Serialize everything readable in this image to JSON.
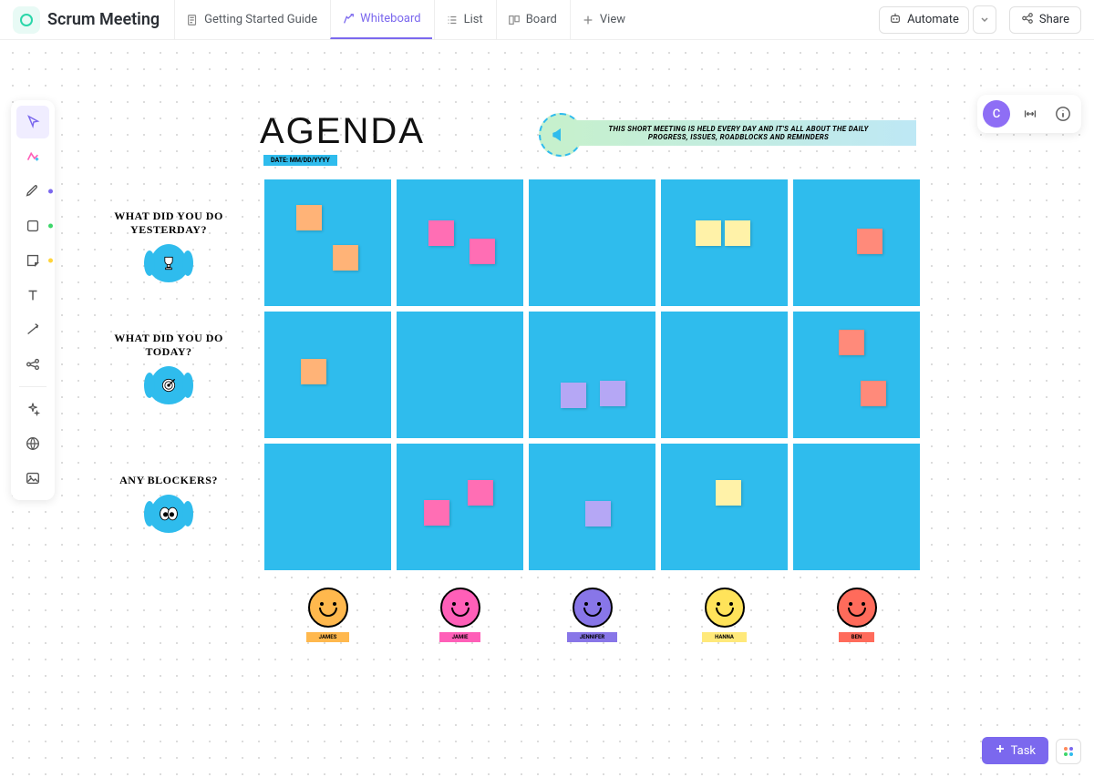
{
  "header": {
    "title": "Scrum Meeting",
    "tabs": [
      {
        "label": "Getting Started Guide"
      },
      {
        "label": "Whiteboard"
      },
      {
        "label": "List"
      },
      {
        "label": "Board"
      },
      {
        "label": "View"
      }
    ],
    "automate": "Automate",
    "share": "Share"
  },
  "avatar": "C",
  "task_button": "Task",
  "board": {
    "agenda": "AGENDA",
    "date_label": "DATE: MM/DD/YYYY",
    "description": "This short meeting is held every day and it's all about the daily progress, issues, roadblocks and reminders",
    "rows": [
      "What did you do yesterday?",
      "What did you do today?",
      "Any blockers?"
    ],
    "people": [
      {
        "name": "JAMES",
        "face": "#ffb84d",
        "tag": "#ffb84d"
      },
      {
        "name": "JAMIE",
        "face": "#ff5fb8",
        "tag": "#ff5fb8"
      },
      {
        "name": "JENNIFER",
        "face": "#8876e8",
        "tag": "#8876e8"
      },
      {
        "name": "HANNA",
        "face": "#ffe35a",
        "tag": "#ffe97a"
      },
      {
        "name": "BEN",
        "face": "#ff6b5b",
        "tag": "#ff6b5b"
      }
    ],
    "stickies": [
      {
        "row": 0,
        "col": 0,
        "x": 35,
        "y": 28,
        "c": "#ffb377"
      },
      {
        "row": 0,
        "col": 0,
        "x": 75,
        "y": 72,
        "c": "#ffb377"
      },
      {
        "row": 0,
        "col": 1,
        "x": 35,
        "y": 45,
        "c": "#ff6eb4"
      },
      {
        "row": 0,
        "col": 1,
        "x": 80,
        "y": 65,
        "c": "#ff6eb4"
      },
      {
        "row": 0,
        "col": 3,
        "x": 38,
        "y": 45,
        "c": "#fff2a8"
      },
      {
        "row": 0,
        "col": 3,
        "x": 70,
        "y": 45,
        "c": "#fff2a8"
      },
      {
        "row": 0,
        "col": 4,
        "x": 70,
        "y": 54,
        "c": "#ff8a7a"
      },
      {
        "row": 1,
        "col": 0,
        "x": 40,
        "y": 52,
        "c": "#ffb377"
      },
      {
        "row": 1,
        "col": 2,
        "x": 35,
        "y": 78,
        "c": "#b5a7f5"
      },
      {
        "row": 1,
        "col": 2,
        "x": 78,
        "y": 76,
        "c": "#b5a7f5"
      },
      {
        "row": 1,
        "col": 4,
        "x": 50,
        "y": 20,
        "c": "#ff8a7a"
      },
      {
        "row": 1,
        "col": 4,
        "x": 74,
        "y": 76,
        "c": "#ff8a7a"
      },
      {
        "row": 2,
        "col": 1,
        "x": 30,
        "y": 62,
        "c": "#ff6eb4"
      },
      {
        "row": 2,
        "col": 1,
        "x": 78,
        "y": 40,
        "c": "#ff6eb4"
      },
      {
        "row": 2,
        "col": 2,
        "x": 62,
        "y": 63,
        "c": "#b5a7f5"
      },
      {
        "row": 2,
        "col": 3,
        "x": 60,
        "y": 40,
        "c": "#fff2a8"
      }
    ]
  }
}
